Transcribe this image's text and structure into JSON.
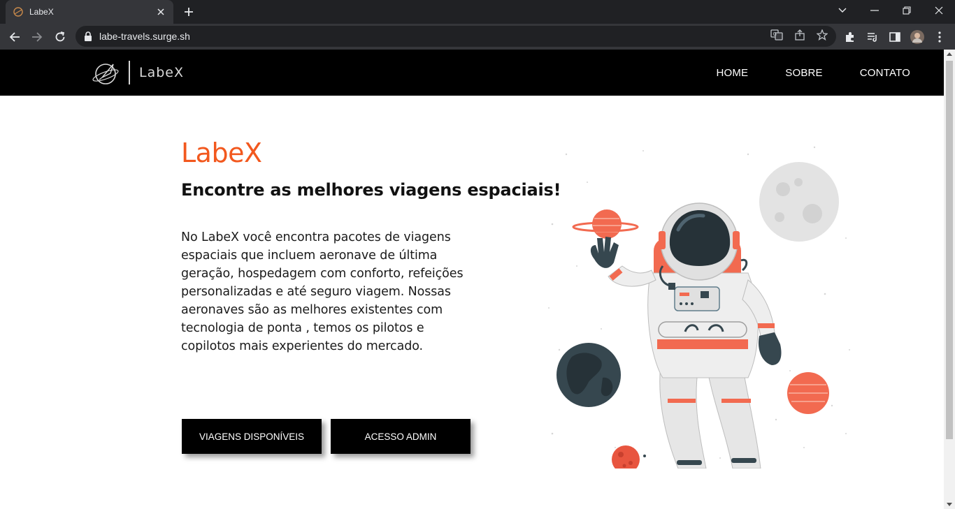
{
  "browser": {
    "tab_title": "LabeX",
    "url": "labe-travels.surge.sh"
  },
  "site": {
    "brand_name": "LabeX",
    "nav": [
      "HOME",
      "SOBRE",
      "CONTATO"
    ]
  },
  "hero": {
    "title": "LabeX",
    "subtitle": "Encontre as melhores viagens espaciais!",
    "description": "No LabeX você encontra pacotes de viagens espaciais que incluem aeronave de última geração, hospedagem com conforto, refeições personalizadas e até seguro viagem. Nossas aeronaves são as melhores existentes com tecnologia de ponta , temos os pilotos e copilotos mais experientes do mercado.",
    "buttons": {
      "trips": "VIAGENS DISPONÍVEIS",
      "admin": "ACESSO ADMIN"
    }
  },
  "colors": {
    "accent": "#f2581e",
    "header_bg": "#000000"
  },
  "icons": {
    "logo": "rocket-planet-icon",
    "illustration": "astronaut-icon"
  }
}
